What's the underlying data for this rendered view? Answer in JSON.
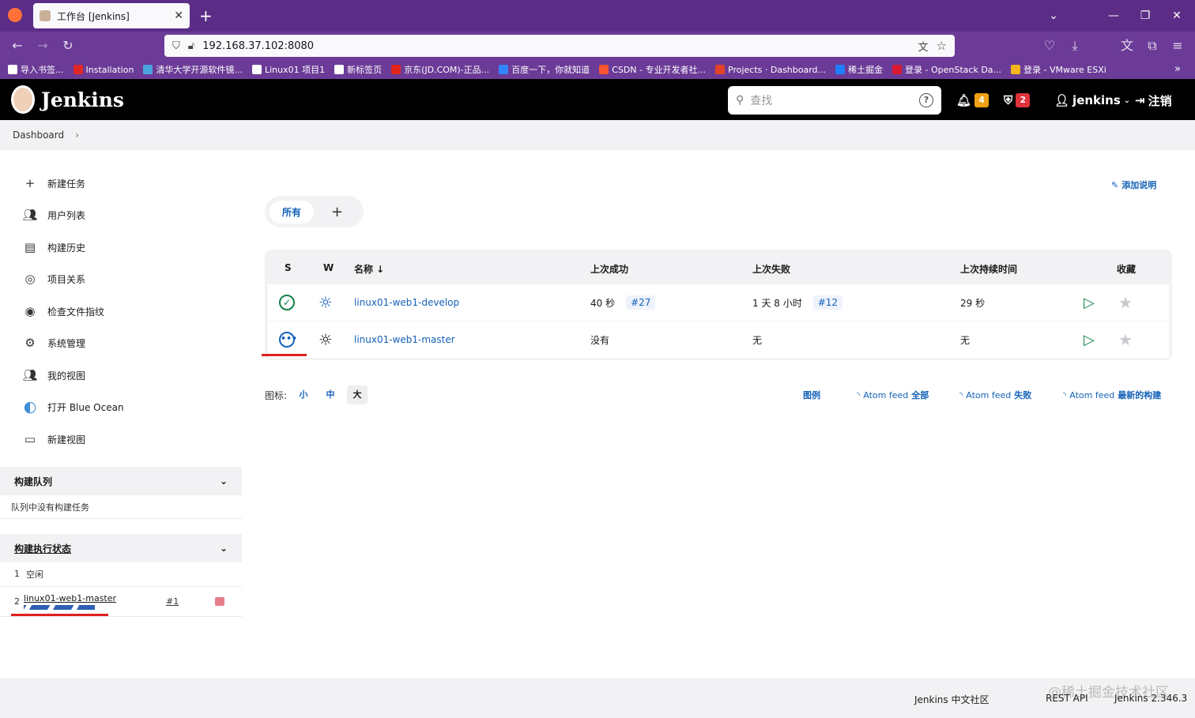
{
  "browser": {
    "tab_title": "工作台 [Jenkins]",
    "url": "192.168.37.102:8080",
    "bookmarks": [
      {
        "label": "导入书签...",
        "color": "#ffffff"
      },
      {
        "label": "Installation",
        "color": "#e02727"
      },
      {
        "label": "清华大学开源软件镜...",
        "color": "#4aa3df"
      },
      {
        "label": "Linux01 项目1",
        "color": "#ffffff"
      },
      {
        "label": "新标签页",
        "color": "#ffffff"
      },
      {
        "label": "京东(JD.COM)-正品...",
        "color": "#e1251b"
      },
      {
        "label": "百度一下，你就知道",
        "color": "#3385ff"
      },
      {
        "label": "CSDN - 专业开发者社...",
        "color": "#fc5531"
      },
      {
        "label": "Projects · Dashboard...",
        "color": "#e24329"
      },
      {
        "label": "稀土掘金",
        "color": "#1e80ff"
      },
      {
        "label": "登录 - OpenStack Da...",
        "color": "#da1a32"
      },
      {
        "label": "登录 - VMware ESXi",
        "color": "#f3b51b"
      }
    ]
  },
  "header": {
    "brand": "Jenkins",
    "search_placeholder": "查找",
    "notifications_count": "4",
    "security_count": "2",
    "user": "jenkins",
    "logout": "注销"
  },
  "breadcrumb": {
    "root": "Dashboard"
  },
  "sidebar": {
    "items": [
      {
        "label": "新建任务",
        "icon": "plus-icon"
      },
      {
        "label": "用户列表",
        "icon": "users-icon"
      },
      {
        "label": "构建历史",
        "icon": "history-icon"
      },
      {
        "label": "项目关系",
        "icon": "relationship-icon"
      },
      {
        "label": "检查文件指纹",
        "icon": "fingerprint-icon"
      },
      {
        "label": "系统管理",
        "icon": "gear-icon"
      },
      {
        "label": "我的视图",
        "icon": "users-icon"
      },
      {
        "label": "打开 Blue Ocean",
        "icon": "blue-ocean-icon"
      },
      {
        "label": "新建视图",
        "icon": "folder-icon"
      }
    ],
    "build_queue": {
      "title": "构建队列",
      "empty_text": "队列中没有构建任务"
    },
    "executors": {
      "title": "构建执行状态",
      "rows": [
        {
          "num": "1",
          "text": "空闲"
        },
        {
          "num": "2",
          "job": "linux01-web1-master",
          "build": "#1"
        }
      ]
    }
  },
  "main": {
    "add_description": "添加说明",
    "view_tabs": {
      "active": "所有",
      "add": "+"
    },
    "table": {
      "headers": {
        "s": "S",
        "w": "W",
        "name": "名称 ↓",
        "last_success": "上次成功",
        "last_failure": "上次失败",
        "last_duration": "上次持续时间",
        "favorite": "收藏"
      },
      "rows": [
        {
          "name": "linux01-web1-develop",
          "last_success": "40 秒",
          "success_build": "#27",
          "last_failure": "1 天 8 小时",
          "failure_build": "#12",
          "duration": "29 秒",
          "status": "success"
        },
        {
          "name": "linux01-web1-master",
          "last_success": "没有",
          "success_build": "",
          "last_failure": "无",
          "failure_build": "",
          "duration": "无",
          "status": "building"
        }
      ]
    },
    "icon_size": {
      "label": "图标:",
      "small": "小",
      "medium": "中",
      "large": "大"
    },
    "feeds": {
      "legend": "图例",
      "all_prefix": "Atom feed",
      "all": "全部",
      "failed_prefix": "Atom feed",
      "failed": "失败",
      "latest_prefix": "Atom feed",
      "latest": "最新的构建"
    }
  },
  "footer": {
    "community": "Jenkins 中文社区",
    "rest_api": "REST API",
    "version": "Jenkins 2.346.3",
    "watermark": "@稀土掘金技术社区"
  },
  "colors": {
    "accent": "#1462b8",
    "success": "#138347",
    "header_bg": "#000000",
    "browser_purple": "#5b2d86",
    "notif_badge": "#f0a116",
    "security_badge": "#e0323a"
  }
}
